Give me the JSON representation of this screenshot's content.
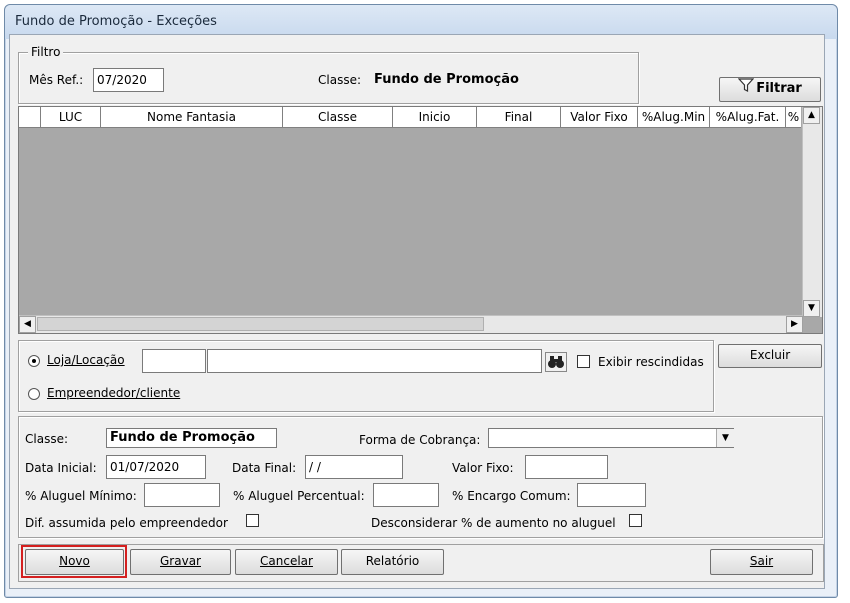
{
  "window": {
    "title": "Fundo de Promoção - Exceções"
  },
  "filter": {
    "group_label": "Filtro",
    "month_label": "Mês Ref.:",
    "month_value": "07/2020",
    "class_label": "Classe:",
    "class_value": "Fundo de Promoção",
    "filter_button": "Filtrar"
  },
  "grid": {
    "columns": [
      "LUC",
      "Nome Fantasia",
      "Classe",
      "Inicio",
      "Final",
      "Valor Fixo",
      "%Alug.Min",
      "%Alug.Fat.",
      "%"
    ]
  },
  "search": {
    "radio_store": "Loja/Locação",
    "radio_owner": "Empreendedor/cliente",
    "selected": "store",
    "show_rescinded": "Exibir rescindidas",
    "delete_button": "Excluir"
  },
  "form": {
    "class_label": "Classe:",
    "class_value": "Fundo de Promoção",
    "billing_label": "Forma de Cobrança:",
    "billing_value": "",
    "start_label": "Data Inicial:",
    "start_value": "01/07/2020",
    "end_label": "Data Final:",
    "end_value": " / /",
    "fixed_label": "Valor Fixo:",
    "fixed_value": "",
    "min_rent_label": "% Aluguel Mínimo:",
    "min_rent_value": "",
    "pct_rent_label": "% Aluguel Percentual:",
    "pct_rent_value": "",
    "charge_label": "% Encargo Comum:",
    "charge_value": "",
    "assumed_label": "Dif. assumida pelo empreendedor",
    "disregard_label": "Desconsiderar % de aumento no aluguel"
  },
  "buttons": {
    "new": "Novo",
    "save": "Gravar",
    "cancel": "Cancelar",
    "report": "Relatório",
    "exit": "Sair"
  },
  "colors": {
    "highlight": "#d42020"
  }
}
